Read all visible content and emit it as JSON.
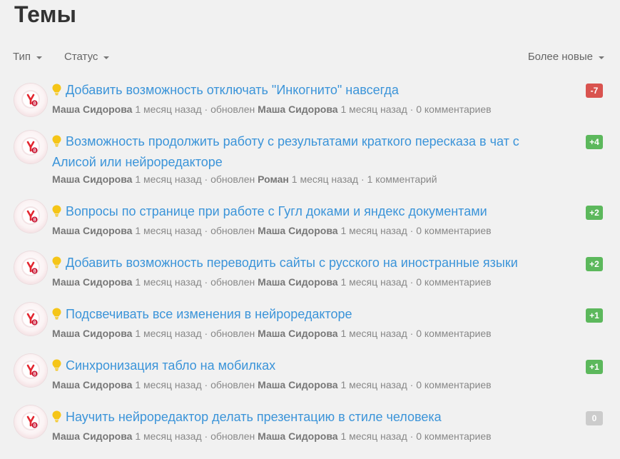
{
  "page": {
    "title": "Темы"
  },
  "filters": {
    "type_label": "Тип",
    "status_label": "Статус",
    "sort_label": "Более новые"
  },
  "colors": {
    "link": "#3b94d9",
    "negative": "#d9534f",
    "positive": "#5cb85c",
    "neutral": "#cccccc",
    "bulb": "#f5c518"
  },
  "topics": [
    {
      "title": "Добавить возможность отключать \"Инкогнито\" навсегда",
      "author": "Маша Сидорова",
      "created": "1 месяц назад",
      "updated_word": "обновлен",
      "updater": "Маша Сидорова",
      "updated": "1 месяц назад",
      "comments": "0 комментариев",
      "votes": "-7",
      "vote_kind": "negative"
    },
    {
      "title": "Возможность продолжить работу с результатами краткого пересказа в чат с Алисой или нейроредакторе",
      "author": "Маша Сидорова",
      "created": "1 месяц назад",
      "updated_word": "обновлен",
      "updater": "Роман",
      "updated": "1 месяц назад",
      "comments": "1 комментарий",
      "votes": "+4",
      "vote_kind": "positive"
    },
    {
      "title": "Вопросы по странице при работе с Гугл доками и яндекс документами",
      "author": "Маша Сидорова",
      "created": "1 месяц назад",
      "updated_word": "обновлен",
      "updater": "Маша Сидорова",
      "updated": "1 месяц назад",
      "comments": "0 комментариев",
      "votes": "+2",
      "vote_kind": "positive"
    },
    {
      "title": "Добавить возможность переводить сайты с русского на иностранные языки",
      "author": "Маша Сидорова",
      "created": "1 месяц назад",
      "updated_word": "обновлен",
      "updater": "Маша Сидорова",
      "updated": "1 месяц назад",
      "comments": "0 комментариев",
      "votes": "+2",
      "vote_kind": "positive"
    },
    {
      "title": "Подсвечивать все изменения в нейроредакторе",
      "author": "Маша Сидорова",
      "created": "1 месяц назад",
      "updated_word": "обновлен",
      "updater": "Маша Сидорова",
      "updated": "1 месяц назад",
      "comments": "0 комментариев",
      "votes": "+1",
      "vote_kind": "positive"
    },
    {
      "title": "Синхронизация табло на мобилках",
      "author": "Маша Сидорова",
      "created": "1 месяц назад",
      "updated_word": "обновлен",
      "updater": "Маша Сидорова",
      "updated": "1 месяц назад",
      "comments": "0 комментариев",
      "votes": "+1",
      "vote_kind": "positive"
    },
    {
      "title": "Научить нейроредактор делать презентацию в стиле человека",
      "author": "Маша Сидорова",
      "created": "1 месяц назад",
      "updated_word": "обновлен",
      "updater": "Маша Сидорова",
      "updated": "1 месяц назад",
      "comments": "0 комментариев",
      "votes": "0",
      "vote_kind": "neutral"
    }
  ]
}
